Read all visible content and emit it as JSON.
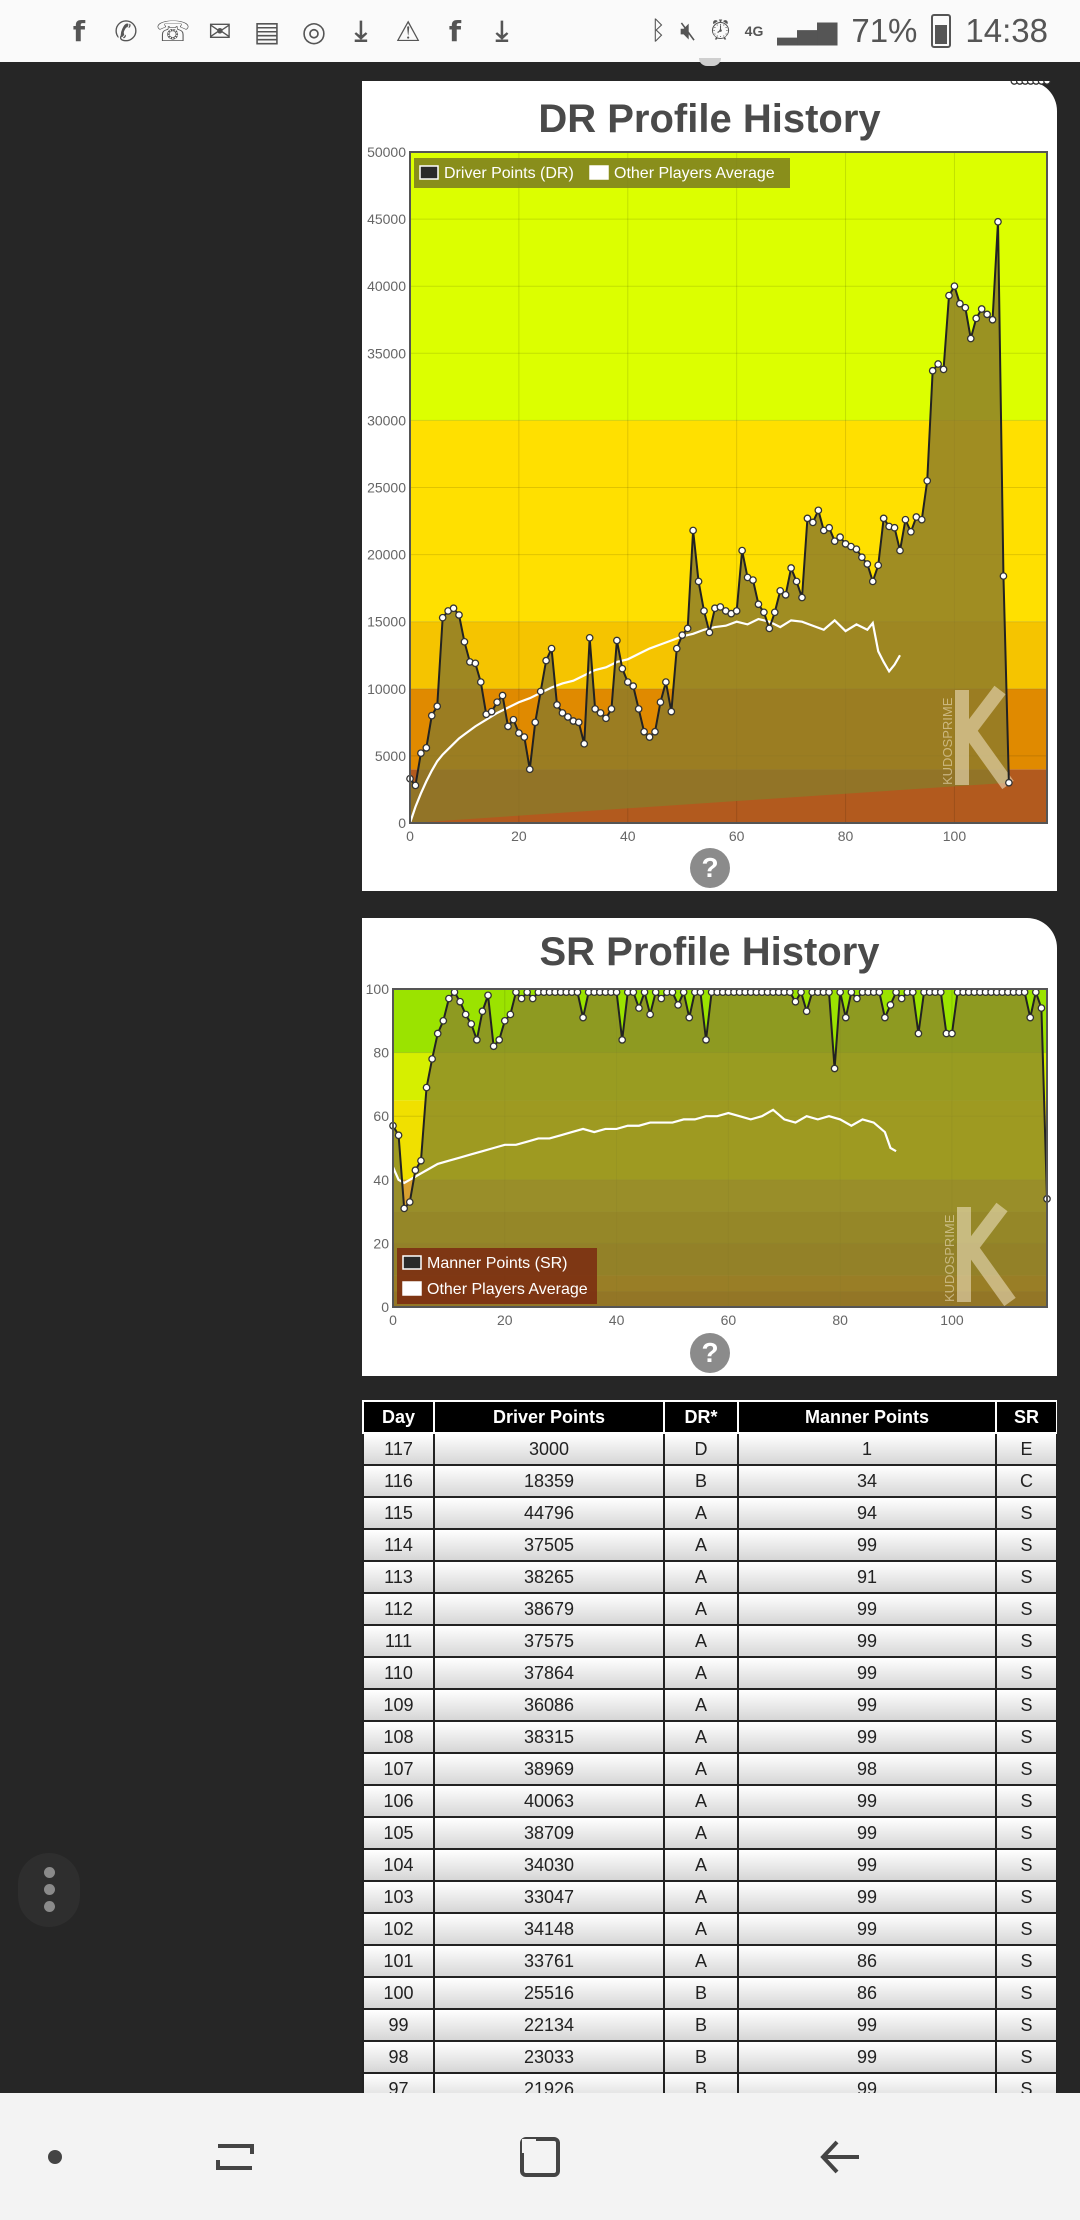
{
  "status_bar": {
    "notification_icons": [
      "facebook-icon",
      "whatsapp-icon",
      "missed-call-icon",
      "gmail-icon",
      "calendar-icon",
      "instagram-icon",
      "download-icon",
      "warning-icon",
      "facebook-icon",
      "download-icon"
    ],
    "network": "4G",
    "battery": "71%",
    "time": "14:38"
  },
  "dr_chart": {
    "title": "DR Profile History",
    "help_label": "?",
    "watermark": "KUDOSPRIME",
    "chart_data": {
      "type": "line",
      "title": "DR Profile History",
      "xlim": [
        0,
        117
      ],
      "ylim": [
        0,
        50000
      ],
      "x_ticks": [
        0,
        20,
        40,
        60,
        80,
        100
      ],
      "y_ticks": [
        0,
        5000,
        10000,
        15000,
        20000,
        25000,
        30000,
        35000,
        40000,
        45000,
        50000
      ],
      "legend_position": "top-left",
      "grid": true,
      "bands": [
        {
          "from": 0,
          "to": 4000,
          "color": "#b25a1e"
        },
        {
          "from": 4000,
          "to": 10000,
          "color": "#e08a00"
        },
        {
          "from": 10000,
          "to": 15000,
          "color": "#f5c400"
        },
        {
          "from": 15000,
          "to": 30000,
          "color": "#ffe000"
        },
        {
          "from": 30000,
          "to": 50000,
          "color": "#dcff00"
        }
      ],
      "series": [
        {
          "name": "Driver Points (DR)",
          "color": "#222222",
          "fill": "#8b7a2a",
          "x": [
            0,
            1,
            2,
            3,
            4,
            5,
            6,
            7,
            8,
            9,
            10,
            11,
            12,
            13,
            14,
            15,
            16,
            17,
            18,
            19,
            20,
            21,
            22,
            23,
            24,
            25,
            26,
            27,
            28,
            29,
            30,
            31,
            32,
            33,
            34,
            35,
            36,
            37,
            38,
            39,
            40,
            41,
            42,
            43,
            44,
            45,
            46,
            47,
            48,
            49,
            50,
            51,
            52,
            53,
            54,
            55,
            56,
            57,
            58,
            59,
            60,
            61,
            62,
            63,
            64,
            65,
            66,
            67,
            68,
            69,
            70,
            71,
            72,
            73,
            74,
            75,
            76,
            77,
            78,
            79,
            80,
            81,
            82,
            83,
            84,
            85,
            86,
            87,
            88,
            89,
            90,
            91,
            92,
            93,
            94,
            95,
            96,
            97,
            98,
            99,
            100,
            101,
            102,
            103,
            104,
            105,
            106,
            107,
            108,
            109,
            110,
            111,
            112,
            113,
            114,
            115,
            116,
            117
          ],
          "y": [
            3300,
            2800,
            5200,
            5600,
            8000,
            8700,
            15300,
            15800,
            16000,
            15500,
            13500,
            12000,
            11900,
            10500,
            8100,
            8300,
            9000,
            9500,
            7200,
            7700,
            6700,
            6400,
            4000,
            7500,
            9800,
            12100,
            13000,
            8800,
            8200,
            7900,
            7600,
            7500,
            5900,
            13800,
            8500,
            8200,
            7800,
            8500,
            13600,
            11500,
            10500,
            10200,
            8500,
            6800,
            6400,
            6800,
            9000,
            10500,
            8300,
            13000,
            14000,
            14500,
            21800,
            18000,
            15800,
            14200,
            16000,
            16100,
            15800,
            15600,
            15800,
            20300,
            18300,
            18100,
            16300,
            15700,
            14500,
            15700,
            17300,
            17000,
            19000,
            18000,
            16800,
            22700,
            22400,
            23300,
            21800,
            22000,
            21000,
            21300,
            20800,
            20600,
            20400,
            19800,
            19300,
            18000,
            19200,
            22700,
            22100,
            22000,
            20300,
            22600,
            21700,
            22800,
            22600,
            25500,
            33700,
            34200,
            33800,
            39300,
            40000,
            38700,
            38400,
            36100,
            37600,
            38300,
            37900,
            37500,
            44800,
            18400,
            3000
          ]
        },
        {
          "name": "Other Players Average",
          "color": "#ffffff",
          "x": [
            0,
            1,
            2,
            3,
            4,
            5,
            6,
            7,
            8,
            9,
            10,
            12,
            14,
            16,
            18,
            20,
            22,
            24,
            26,
            28,
            30,
            32,
            34,
            36,
            38,
            40,
            42,
            44,
            46,
            48,
            50,
            52,
            54,
            56,
            58,
            60,
            62,
            64,
            66,
            68,
            70,
            72,
            74,
            76,
            78,
            80,
            82,
            84,
            85,
            86,
            87,
            88,
            89,
            90
          ],
          "y": [
            0,
            1200,
            2200,
            3100,
            3900,
            4600,
            5100,
            5500,
            5900,
            6300,
            6600,
            7200,
            7700,
            8200,
            8600,
            9000,
            9300,
            9700,
            10100,
            10400,
            10600,
            11000,
            11400,
            11600,
            12000,
            12200,
            12600,
            13000,
            13300,
            13600,
            13900,
            14100,
            14400,
            14600,
            14700,
            15000,
            14800,
            15200,
            15000,
            14600,
            15100,
            15000,
            14700,
            14400,
            15100,
            14300,
            14800,
            14400,
            14900,
            12800,
            12000,
            11300,
            11800,
            12500
          ]
        }
      ]
    }
  },
  "sr_chart": {
    "title": "SR Profile History",
    "help_label": "?",
    "watermark": "KUDOSPRIME",
    "chart_data": {
      "type": "line",
      "title": "SR Profile History",
      "xlim": [
        0,
        117
      ],
      "ylim": [
        0,
        100
      ],
      "x_ticks": [
        0,
        20,
        40,
        60,
        80,
        100
      ],
      "y_ticks": [
        0,
        20,
        40,
        60,
        80,
        100
      ],
      "legend_position": "bottom-left",
      "grid": true,
      "bands": [
        {
          "from": 0,
          "to": 5,
          "color": "#b81e1e"
        },
        {
          "from": 5,
          "to": 10,
          "color": "#d64a1e"
        },
        {
          "from": 10,
          "to": 20,
          "color": "#b55a28"
        },
        {
          "from": 20,
          "to": 30,
          "color": "#c47828"
        },
        {
          "from": 30,
          "to": 40,
          "color": "#d8a030"
        },
        {
          "from": 40,
          "to": 65,
          "color": "#f0e000"
        },
        {
          "from": 65,
          "to": 80,
          "color": "#d6ef00"
        },
        {
          "from": 80,
          "to": 100,
          "color": "#9be300"
        }
      ],
      "series": [
        {
          "name": "Manner Points (SR)",
          "color": "#222222",
          "fill": "#8b8a28",
          "x": [
            0,
            1,
            2,
            3,
            4,
            5,
            6,
            7,
            8,
            9,
            10,
            11,
            12,
            13,
            14,
            15,
            16,
            17,
            18,
            19,
            20,
            21,
            22,
            23,
            24,
            25,
            26,
            27,
            28,
            29,
            30,
            31,
            32,
            33,
            34,
            35,
            36,
            37,
            38,
            39,
            40,
            41,
            42,
            43,
            44,
            45,
            46,
            47,
            48,
            49,
            50,
            51,
            52,
            53,
            54,
            55,
            56,
            57,
            58,
            59,
            60,
            61,
            62,
            63,
            64,
            65,
            66,
            67,
            68,
            69,
            70,
            71,
            72,
            73,
            74,
            75,
            76,
            77,
            78,
            79,
            80,
            81,
            82,
            83,
            84,
            85,
            86,
            87,
            88,
            89,
            90,
            91,
            92,
            93,
            94,
            95,
            96,
            97,
            98,
            99,
            100,
            101,
            102,
            103,
            104,
            105,
            106,
            107,
            108,
            109,
            110,
            111,
            112,
            113,
            114,
            115,
            116,
            117
          ],
          "y": [
            57,
            54,
            31,
            33,
            43,
            46,
            69,
            78,
            86,
            90,
            97,
            99,
            96,
            92,
            89,
            84,
            93,
            98,
            82,
            84,
            90,
            92,
            99,
            97,
            99,
            97,
            99,
            99,
            99,
            99,
            99,
            99,
            99,
            99,
            91,
            99,
            99,
            99,
            99,
            99,
            99,
            84,
            99,
            99,
            94,
            99,
            92,
            99,
            97,
            99,
            99,
            95,
            99,
            91,
            99,
            99,
            84,
            99,
            99,
            99,
            99,
            99,
            99,
            99,
            99,
            99,
            99,
            99,
            99,
            99,
            99,
            99,
            96,
            99,
            93,
            99,
            99,
            99,
            99,
            75,
            99,
            91,
            99,
            97,
            99,
            99,
            99,
            99,
            91,
            95,
            99,
            97,
            99,
            99,
            86,
            99,
            99,
            99,
            99,
            86,
            86,
            99,
            99,
            99,
            99,
            99,
            99,
            99,
            99,
            99,
            99,
            99,
            99,
            99,
            91,
            99,
            94,
            34
          ]
        },
        {
          "name": "Other Players Average",
          "color": "#ffffff",
          "x": [
            0,
            1,
            2,
            3,
            4,
            5,
            6,
            8,
            10,
            12,
            14,
            16,
            18,
            20,
            22,
            24,
            26,
            28,
            30,
            32,
            34,
            36,
            38,
            40,
            42,
            44,
            46,
            48,
            50,
            52,
            54,
            56,
            58,
            60,
            62,
            64,
            66,
            68,
            70,
            72,
            74,
            76,
            78,
            80,
            82,
            84,
            86,
            88,
            89,
            90
          ],
          "y": [
            44,
            40,
            39,
            40,
            41,
            42,
            43,
            45,
            46,
            47,
            48,
            49,
            50,
            51,
            51,
            52,
            53,
            53,
            54,
            55,
            56,
            55,
            56,
            56,
            57,
            57,
            58,
            58,
            58,
            59,
            59,
            60,
            60,
            61,
            60,
            59,
            60,
            62,
            59,
            58,
            60,
            59,
            60,
            59,
            57,
            59,
            58,
            55,
            50,
            49
          ]
        }
      ]
    }
  },
  "table": {
    "headers": [
      "Day",
      "Driver Points",
      "DR*",
      "Manner Points",
      "SR"
    ],
    "rows": [
      [
        "117",
        "3000",
        "D",
        "1",
        "E"
      ],
      [
        "116",
        "18359",
        "B",
        "34",
        "C"
      ],
      [
        "115",
        "44796",
        "A",
        "94",
        "S"
      ],
      [
        "114",
        "37505",
        "A",
        "99",
        "S"
      ],
      [
        "113",
        "38265",
        "A",
        "91",
        "S"
      ],
      [
        "112",
        "38679",
        "A",
        "99",
        "S"
      ],
      [
        "111",
        "37575",
        "A",
        "99",
        "S"
      ],
      [
        "110",
        "37864",
        "A",
        "99",
        "S"
      ],
      [
        "109",
        "36086",
        "A",
        "99",
        "S"
      ],
      [
        "108",
        "38315",
        "A",
        "99",
        "S"
      ],
      [
        "107",
        "38969",
        "A",
        "98",
        "S"
      ],
      [
        "106",
        "40063",
        "A",
        "99",
        "S"
      ],
      [
        "105",
        "38709",
        "A",
        "99",
        "S"
      ],
      [
        "104",
        "34030",
        "A",
        "99",
        "S"
      ],
      [
        "103",
        "33047",
        "A",
        "99",
        "S"
      ],
      [
        "102",
        "34148",
        "A",
        "99",
        "S"
      ],
      [
        "101",
        "33761",
        "A",
        "86",
        "S"
      ],
      [
        "100",
        "25516",
        "B",
        "86",
        "S"
      ],
      [
        "99",
        "22134",
        "B",
        "99",
        "S"
      ],
      [
        "98",
        "23033",
        "B",
        "99",
        "S"
      ],
      [
        "97",
        "21926",
        "B",
        "99",
        "S"
      ]
    ]
  },
  "colors": {
    "page_bg": "#262626",
    "card_bg": "#ffffff",
    "header_bg": "#000000"
  }
}
